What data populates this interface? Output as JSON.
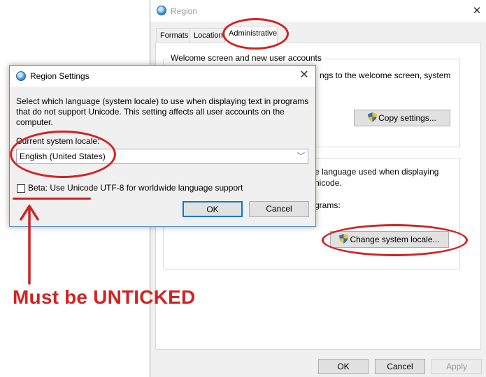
{
  "region_window": {
    "title": "Region",
    "tabs": [
      "Formats",
      "Location",
      "Administrative"
    ],
    "welcome_group_title": "Welcome screen and new user accounts",
    "welcome_desc": "ngs to the welcome screen, system",
    "copy_settings_label": "Copy settings...",
    "nonunicode_desc": "e language used when displaying",
    "nonunicode_desc_line2": "nicode.",
    "nonunicode_desc3": "grams:",
    "change_locale_label": "Change system locale...",
    "ok_label": "OK",
    "cancel_label": "Cancel",
    "apply_label": "Apply"
  },
  "settings_dialog": {
    "title": "Region Settings",
    "description": "Select which language (system locale) to use when displaying text in programs that do not support Unicode. This setting affects all user accounts on the computer.",
    "locale_label": "Current system locale:",
    "locale_value": "English (United States)",
    "beta_label": "Beta: Use Unicode UTF-8 for worldwide language support",
    "beta_checked": false,
    "ok_label": "OK",
    "cancel_label": "Cancel"
  },
  "annotation": {
    "text": "Must be UNTICKED",
    "color": "#d32222"
  },
  "icons": {
    "window_icon": "globe-icon",
    "button_icon": "uac-shield-icon",
    "close": "close-icon",
    "dropdown": "chevron-down-icon"
  }
}
